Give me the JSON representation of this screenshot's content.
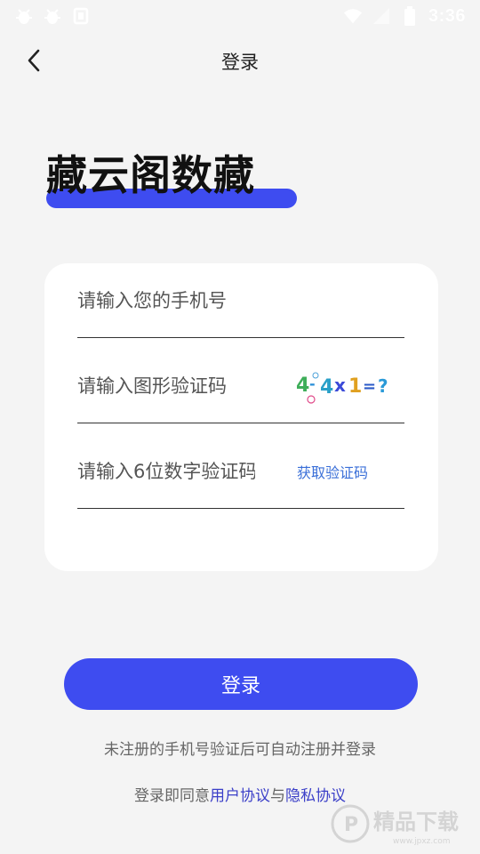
{
  "status_bar": {
    "time": "3:36",
    "left_icons": [
      "bug-icon",
      "bug-icon",
      "app-notification-icon"
    ],
    "right_icons": [
      "wifi-icon",
      "signal-icon",
      "battery-icon"
    ]
  },
  "header": {
    "title": "登录",
    "back_icon": "chevron-left-icon"
  },
  "brand": {
    "name": "藏云阁数藏",
    "underline_color": "#3e4cf0"
  },
  "form": {
    "phone": {
      "placeholder": "请输入您的手机号",
      "value": ""
    },
    "captcha": {
      "placeholder": "请输入图形验证码",
      "value": "",
      "image_text": "4-4x1=?"
    },
    "sms": {
      "placeholder": "请输入6位数字验证码",
      "value": "",
      "get_code_label": "获取验证码"
    }
  },
  "login_button": {
    "label": "登录",
    "color": "#3e4cf0"
  },
  "register_hint": "未注册的手机号验证后可自动注册并登录",
  "agreement": {
    "prefix": "登录即同意",
    "user_agreement": "用户协议",
    "and": "与",
    "privacy_agreement": "隐私协议",
    "link_color": "#3b3fc8"
  },
  "watermark": {
    "text": "精品下载",
    "subtext": "www.jpxz.com"
  }
}
